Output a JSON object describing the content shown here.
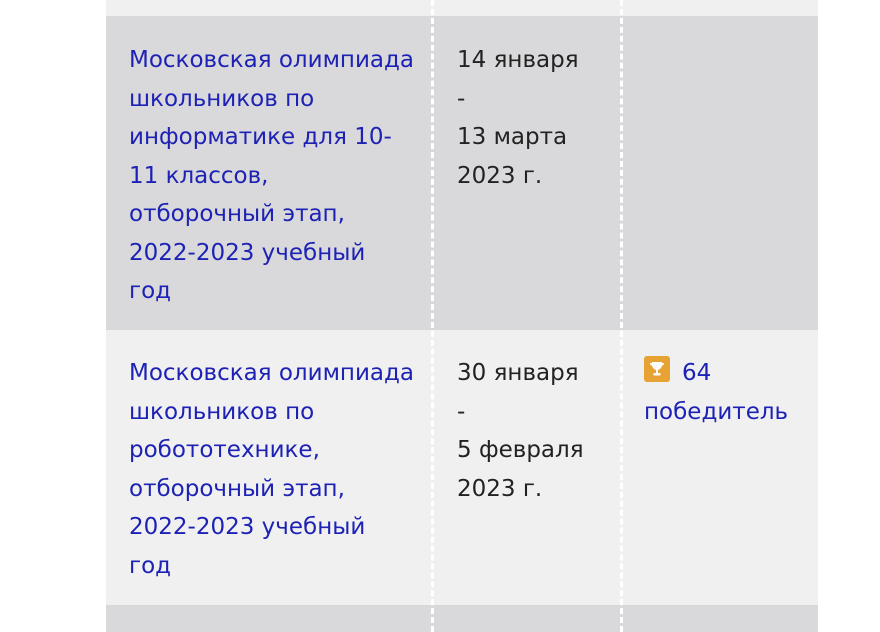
{
  "rows": [
    {
      "event": "Московская олимпиада\nшкольников по\nинформатике для 10-\n11 классов,\nотборочный этап,\n2022-2023 учебный\nгод",
      "dates": "14 января\n-\n13 марта\n2023 г.",
      "result": null
    },
    {
      "event": "Московская олимпиада\nшкольников по\nробототехнике,\nотборочный этап,\n2022-2023 учебный\nгод",
      "dates": "30 января\n-\n5 февраля\n2023 г.",
      "result": {
        "icon": "trophy-icon",
        "score": "64",
        "status": "победитель"
      }
    }
  ],
  "colors": {
    "link": "#1d22b5",
    "row_dark": "#d9d9db",
    "row_light": "#f0f0f0",
    "trophy": "#e7a234"
  }
}
